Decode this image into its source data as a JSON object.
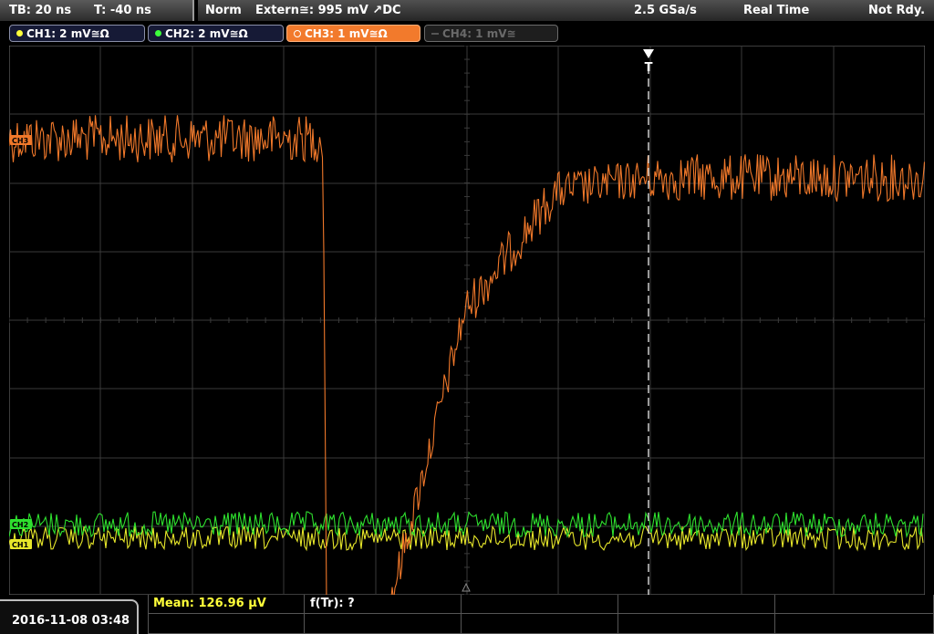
{
  "timebase": {
    "tb": "TB: 20 ns",
    "t": "T: -40 ns"
  },
  "status": {
    "mode": "Norm",
    "trigger": "Extern≅: 995 mV ↗DC",
    "sample_rate": "2.5 GSa/s",
    "acq": "Real Time",
    "state": "Not Rdy."
  },
  "channels": [
    {
      "label": "CH1: 2 mV≅Ω",
      "color": "#ffff3a",
      "active": true
    },
    {
      "label": "CH2: 2 mV≅Ω",
      "color": "#3cff3c",
      "active": true
    },
    {
      "label": "CH3: 1 mV≅Ω",
      "color": "#f27a2c",
      "active": true,
      "selected": true
    },
    {
      "label": "CH4: 1 mV≅",
      "color": "#6a6a6a",
      "active": false
    }
  ],
  "markers": {
    "ch3": "CH3",
    "ch2": "CH2",
    "ch1": "CH1",
    "trigger": "T"
  },
  "bottom": {
    "datetime": "2016-11-08 03:48",
    "mean": "Mean: 126.96 μV",
    "ftr": "f(Tr): ?"
  },
  "waveform_colors": {
    "ch1": "#e7e72a",
    "ch2": "#2ee02e",
    "ch3": "#f0782a",
    "grid": "#3a3a3a",
    "trigger_line": "#ffffff"
  }
}
